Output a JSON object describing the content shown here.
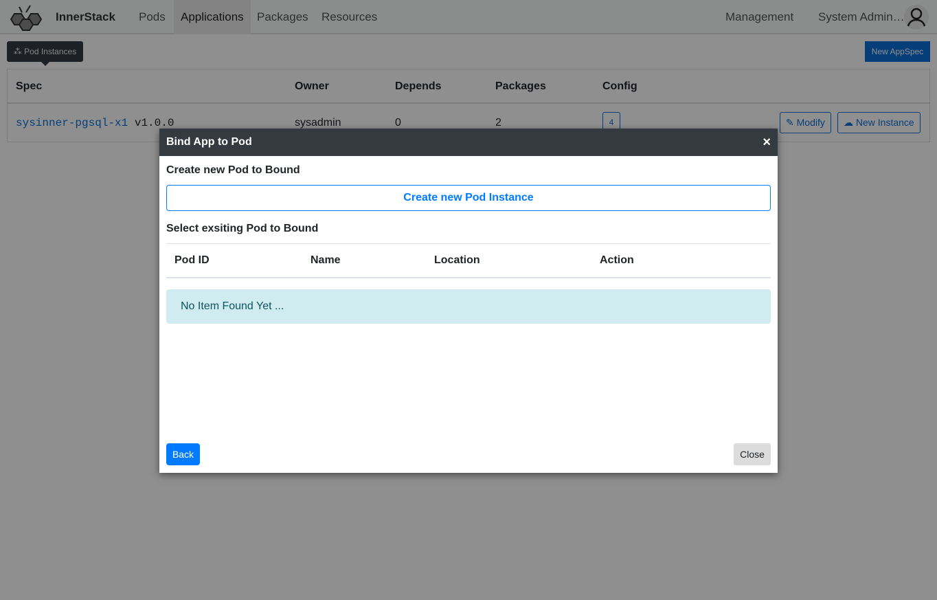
{
  "navbar": {
    "brand": "InnerStack",
    "items": [
      "Pods",
      "Applications",
      "Packages",
      "Resources"
    ],
    "active": "Applications",
    "management": "Management",
    "user": "System Admin…"
  },
  "toolbar": {
    "pod_instances": "Pod Instances",
    "new_appspec": "New AppSpec"
  },
  "table": {
    "headers": [
      "Spec",
      "Owner",
      "Depends",
      "Packages",
      "Config"
    ],
    "rows": [
      {
        "spec_name": "sysinner-pgsql-x1",
        "version": "v1.0.0",
        "owner": "sysadmin",
        "depends": "0",
        "packages": "2",
        "config": "4",
        "modify": "Modify",
        "new_instance": "New Instance"
      }
    ]
  },
  "modal": {
    "title": "Bind App to Pod",
    "close_symbol": "×",
    "create_heading": "Create new Pod to Bound",
    "create_button": "Create new Pod Instance",
    "select_heading": "Select exsiting Pod to Bound",
    "headers": [
      "Pod ID",
      "Name",
      "Location",
      "Action"
    ],
    "empty": "No Item Found Yet ...",
    "back": "Back",
    "close": "Close"
  },
  "colors": {
    "primary": "#007bff",
    "dark": "#343a40",
    "info_bg": "#d1ecf1"
  }
}
